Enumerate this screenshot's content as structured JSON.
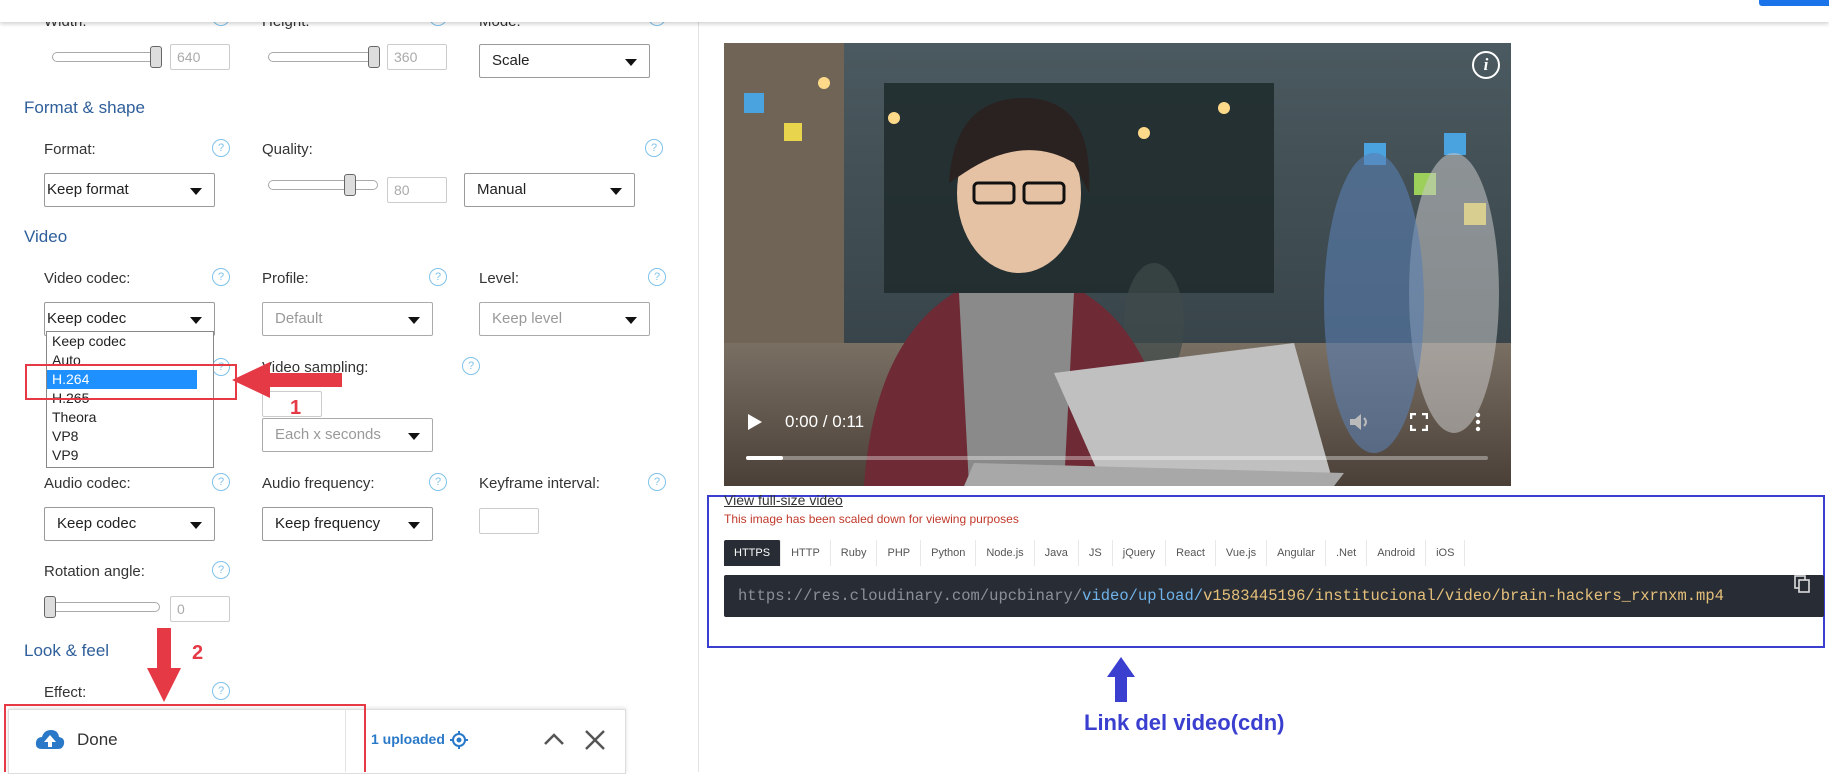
{
  "left": {
    "top_labels": {
      "width": "Width:",
      "height": "Height:",
      "mode": "Mode:"
    },
    "width_value": "640",
    "height_value": "360",
    "mode_select": "Scale",
    "section_format": "Format & shape",
    "format_label": "Format:",
    "format_select": "Keep format",
    "quality_label": "Quality:",
    "quality_value": "80",
    "quality_select": "Manual",
    "section_video": "Video",
    "video_codec_label": "Video codec:",
    "video_codec_select": "Keep codec",
    "profile_label": "Profile:",
    "profile_select": "Default",
    "level_label": "Level:",
    "level_select": "Keep level",
    "codec_options": [
      "Keep codec",
      "Auto",
      "H.264",
      "H.265",
      "Theora",
      "VP8",
      "VP9"
    ],
    "video_sampling_label": "Video sampling:",
    "video_sampling_select": "Each x seconds",
    "audio_codec_label": "Audio codec:",
    "audio_codec_select": "Keep codec",
    "audio_freq_label": "Audio frequency:",
    "audio_freq_select": "Keep frequency",
    "keyframe_label": "Keyframe interval:",
    "rotation_label": "Rotation angle:",
    "rotation_value": "0",
    "section_look": "Look & feel",
    "effect_label": "Effect:",
    "help_glyph": "?"
  },
  "annotations": {
    "step1": "1",
    "step2": "2",
    "link_caption": "Link del video(cdn)"
  },
  "upload_bar": {
    "done_label": "Done",
    "uploaded_text": "1 uploaded"
  },
  "video": {
    "time": "0:00 / 0:11",
    "progress": 0.05,
    "info_glyph": "i"
  },
  "preview": {
    "view_full": "View full-size video",
    "scaled_note": "This image has been scaled down for viewing purposes",
    "tabs": [
      "HTTPS",
      "HTTP",
      "Ruby",
      "PHP",
      "Python",
      "Node.js",
      "Java",
      "JS",
      "jQuery",
      "React",
      "Vue.js",
      "Angular",
      ".Net",
      "Android",
      "iOS"
    ],
    "url_part1": "https://res.cloudinary.com/upcbinary/",
    "url_part2": "video/upload/",
    "url_part3": "v1583445196/institucional/video/brain-hackers_rxrnxm.mp4"
  },
  "colors": {
    "accent_blue": "#2f5f9a",
    "annotation_red": "#e63946",
    "annotation_blue": "#3a3fcf",
    "code_bg": "#282c34"
  }
}
